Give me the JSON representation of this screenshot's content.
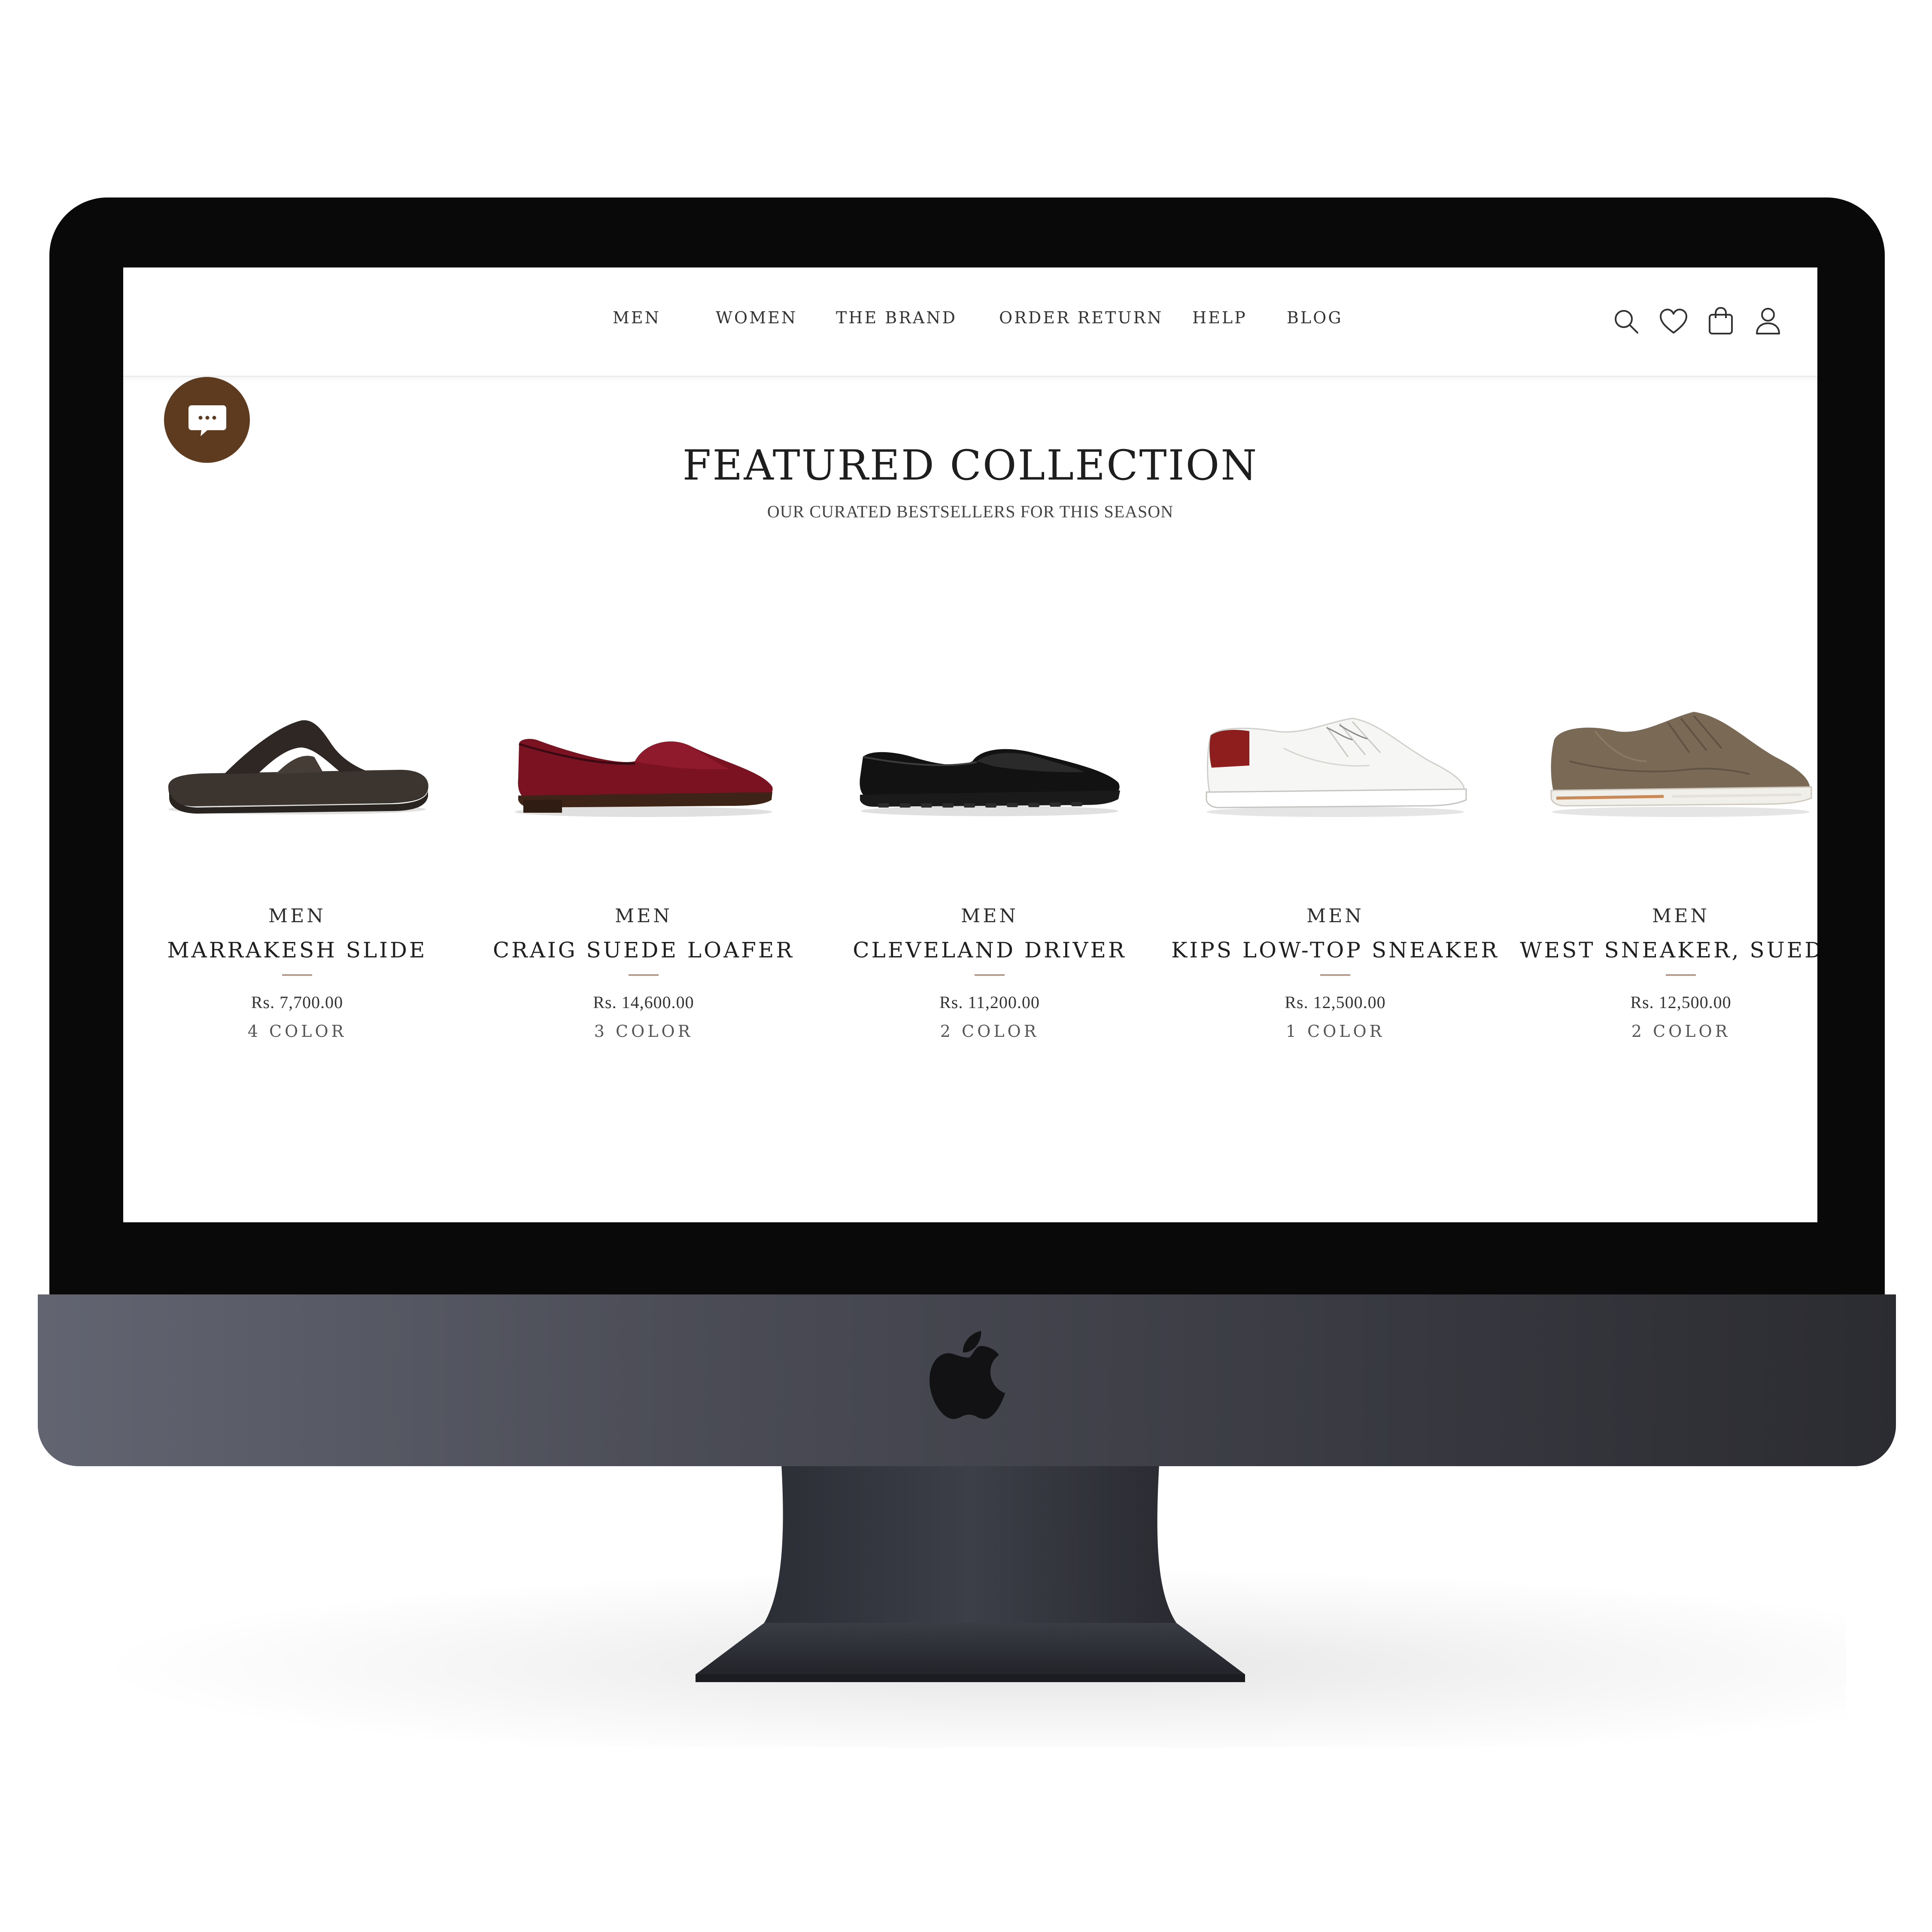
{
  "nav": {
    "items": [
      {
        "label": "MEN"
      },
      {
        "label": "WOMEN"
      },
      {
        "label": "THE BRAND"
      },
      {
        "label": "ORDER RETURN"
      },
      {
        "label": "HELP"
      },
      {
        "label": "BLOG"
      }
    ],
    "icons": [
      "search-icon",
      "heart-icon",
      "shopping-bag-icon",
      "user-icon"
    ]
  },
  "chat": {
    "icon": "chat-bubble-icon",
    "color": "#5e3a1e"
  },
  "section": {
    "title": "FEATURED COLLECTION",
    "subtitle": "OUR CURATED BESTSELLERS FOR THIS SEASON"
  },
  "products": [
    {
      "category": "MEN",
      "name": "MARRAKESH SLIDE",
      "price": "Rs. 7,700.00",
      "colors": "4 COLOR",
      "image": "dark-brown-leather-slide-sandal"
    },
    {
      "category": "MEN",
      "name": "CRAIG SUEDE LOAFER",
      "price": "Rs. 14,600.00",
      "colors": "3 COLOR",
      "image": "burgundy-suede-loafer"
    },
    {
      "category": "MEN",
      "name": "CLEVELAND DRIVER",
      "price": "Rs. 11,200.00",
      "colors": "2 COLOR",
      "image": "black-leather-driving-moccasin"
    },
    {
      "category": "MEN",
      "name": "KIPS LOW-TOP SNEAKER",
      "price": "Rs. 12,500.00",
      "colors": "1 COLOR",
      "image": "white-leather-sneaker-red-heel"
    },
    {
      "category": "MEN",
      "name": "WEST SNEAKER, SUEDE",
      "price": "Rs. 12,500.00",
      "colors": "2 COLOR",
      "image": "olive-suede-sneaker"
    }
  ],
  "colors": {
    "accent_rule": "#b89a8a",
    "chat_brown": "#5e3a1e",
    "bezel": "#090909",
    "chin": "#4b4c56"
  }
}
